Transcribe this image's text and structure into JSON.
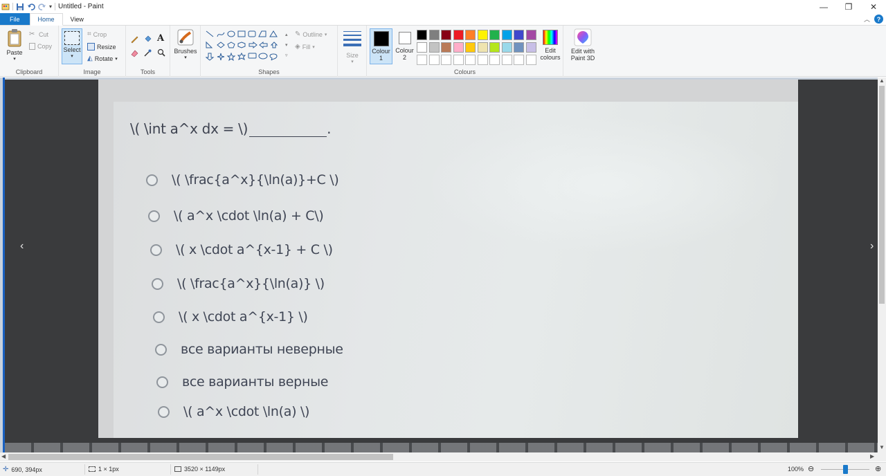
{
  "window": {
    "title": "Untitled - Paint",
    "minimize_glyph": "—",
    "restore_glyph": "❐",
    "close_glyph": "✕"
  },
  "tabs": [
    {
      "label": "File"
    },
    {
      "label": "Home"
    },
    {
      "label": "View"
    }
  ],
  "ribbon": {
    "clipboard": {
      "label": "Clipboard",
      "paste": "Paste",
      "cut": "Cut",
      "copy": "Copy"
    },
    "image": {
      "label": "Image",
      "select": "Select",
      "crop": "Crop",
      "resize": "Resize",
      "rotate": "Rotate"
    },
    "tools": {
      "label": "Tools"
    },
    "brushes": {
      "label": "Brushes"
    },
    "shapes": {
      "label": "Shapes",
      "outline": "Outline",
      "fill": "Fill"
    },
    "size": {
      "label": "Size"
    },
    "colours": {
      "label": "Colours",
      "colour1": "Colour 1",
      "colour1_line1": "Colour",
      "colour1_line2": "1",
      "colour2_line1": "Colour",
      "colour2_line2": "2",
      "colour1_value": "#000000",
      "colour2_value": "#ffffff",
      "edit_line1": "Edit",
      "edit_line2": "colours",
      "row1": [
        "#000000",
        "#7f7f7f",
        "#880015",
        "#ed1c24",
        "#ff7f27",
        "#fff200",
        "#22b14c",
        "#00a2e8",
        "#3f48cc",
        "#a349a4"
      ],
      "row2": [
        "#ffffff",
        "#c3c3c3",
        "#b97a57",
        "#ffaec9",
        "#ffc90e",
        "#efe4b0",
        "#b5e61d",
        "#99d9ea",
        "#7092be",
        "#c8bfe7"
      ]
    },
    "paint3d": {
      "line1": "Edit with",
      "line2": "Paint 3D"
    }
  },
  "canvas": {
    "question": "\\( \\int a^x dx = \\)",
    "question_tail": ".",
    "options": [
      "\\(  \\frac{a^x}{\\ln(a)}+C \\)",
      "\\( a^x \\cdot \\ln(a) + C\\)",
      "\\( x \\cdot a^{x-1} + C \\)",
      "\\(  \\frac{a^x}{\\ln(a)} \\)",
      "\\( x \\cdot a^{x-1}  \\)",
      "все варианты неверные",
      "все варианты верные",
      "\\( a^x \\cdot \\ln(a) \\)"
    ],
    "prev_glyph": "‹",
    "next_glyph": "›"
  },
  "statusbar": {
    "cursor": "690, 394px",
    "selection": "1 × 1px",
    "image_size": "3520 × 1149px",
    "zoom": "100%"
  }
}
